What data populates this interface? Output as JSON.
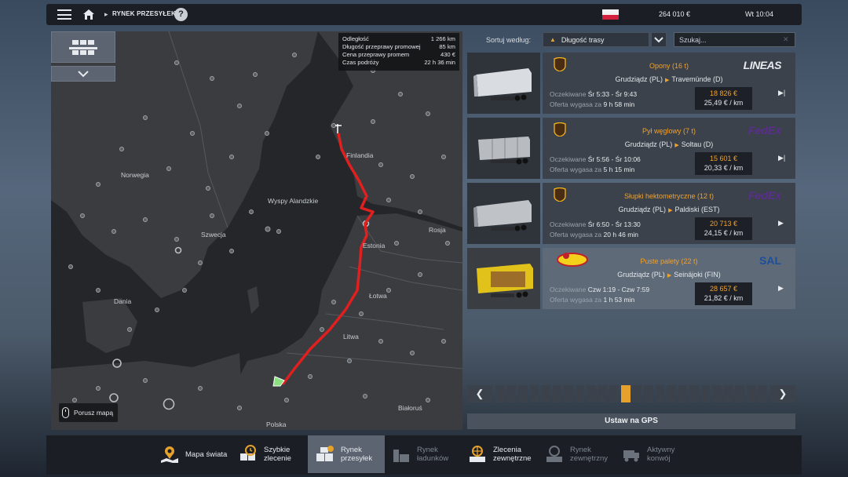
{
  "topbar": {
    "breadcrumb": "RYNEK PRZESYŁEK",
    "help": "?",
    "money": "264 010 €",
    "clock": "Wt 10:04",
    "colors": {
      "accent": "#e6a12c"
    }
  },
  "map": {
    "route_info": [
      {
        "label": "Odległość",
        "value": "1 266 km"
      },
      {
        "label": "Długość przeprawy promowej",
        "value": "85 km"
      },
      {
        "label": "Cena przeprawy promem",
        "value": "430 €"
      },
      {
        "label": "Czas podróży",
        "value": "22 h 36 min"
      }
    ],
    "labels": {
      "norwegia": "Norwegia",
      "finlandia": "Finlandia",
      "wyspy": "Wyspy Alandzkie",
      "szwecja": "Szwecja",
      "rosja": "Rosja",
      "estonia": "Estonia",
      "lotwa": "Łotwa",
      "dania": "Dania",
      "litwa": "Litwa",
      "bialorus": "Białoruś",
      "polska": "Polska"
    },
    "hint": "Porusz mapą"
  },
  "panel": {
    "sort_label": "Sortuj według:",
    "sort_value": "Długość trasy",
    "search_placeholder": "Szukaj...",
    "gps_button": "Ustaw na GPS",
    "offers": [
      {
        "cargo": "Opony (16 t)",
        "from": "Grudziądz (PL)",
        "to": "Travemünde (D)",
        "expected_label": "Oczekiwane",
        "expected": "Śr 5:33 - Śr 9:43",
        "expires_label": "Oferta wygasa za",
        "expires": "9 h 58 min",
        "price": "18 826 €",
        "rate": "25,49 € / km",
        "logo": "LINEAS",
        "company_icon": "ups-icon"
      },
      {
        "cargo": "Pył węglowy (7 t)",
        "from": "Grudziądz (PL)",
        "to": "Soltau (D)",
        "expected_label": "Oczekiwane",
        "expected": "Śr 5:56 - Śr 10:06",
        "expires_label": "Oferta wygasa za",
        "expires": "5 h 15 min",
        "price": "15 601 €",
        "rate": "20,33 € / km",
        "logo": "FedEx",
        "company_icon": "ups-icon"
      },
      {
        "cargo": "Słupki hektometryczne (12 t)",
        "from": "Grudziądz (PL)",
        "to": "Paldiski (EST)",
        "expected_label": "Oczekiwane",
        "expected": "Śr 6:50 - Śr 13:30",
        "expires_label": "Oferta wygasa za",
        "expires": "20 h 46 min",
        "price": "20 713 €",
        "rate": "24,15 € / km",
        "logo": "FedEx",
        "company_icon": "ups-icon"
      },
      {
        "cargo": "Puste palety (22 t)",
        "from": "Grudziądz (PL)",
        "to": "Seinäjoki (FIN)",
        "expected_label": "Oczekiwane",
        "expected": "Czw 1:19 - Czw 7:59",
        "expires_label": "Oferta wygasa za",
        "expires": "1 h 53 min",
        "price": "28 657 €",
        "rate": "21,82 € / km",
        "logo": "SAL",
        "company_icon": "bakery-icon"
      }
    ],
    "pager": {
      "pages": 24,
      "current": 12
    }
  },
  "bottom_tabs": [
    {
      "label": "Mapa świata",
      "icon": "world-map-icon",
      "state": "normal"
    },
    {
      "label": "Szybkie\nzlecenie",
      "icon": "quick-job-icon",
      "state": "normal"
    },
    {
      "label": "Rynek\nprzesyłek",
      "icon": "cargo-market-icon",
      "state": "active"
    },
    {
      "label": "Rynek\nładunków",
      "icon": "freight-market-icon",
      "state": "dim"
    },
    {
      "label": "Zlecenia\nzewnętrzne",
      "icon": "external-contracts-icon",
      "state": "normal"
    },
    {
      "label": "Rynek\nzewnętrzny",
      "icon": "external-market-icon",
      "state": "dim"
    },
    {
      "label": "Aktywny\nkonwój",
      "icon": "convoy-icon",
      "state": "dim"
    }
  ]
}
